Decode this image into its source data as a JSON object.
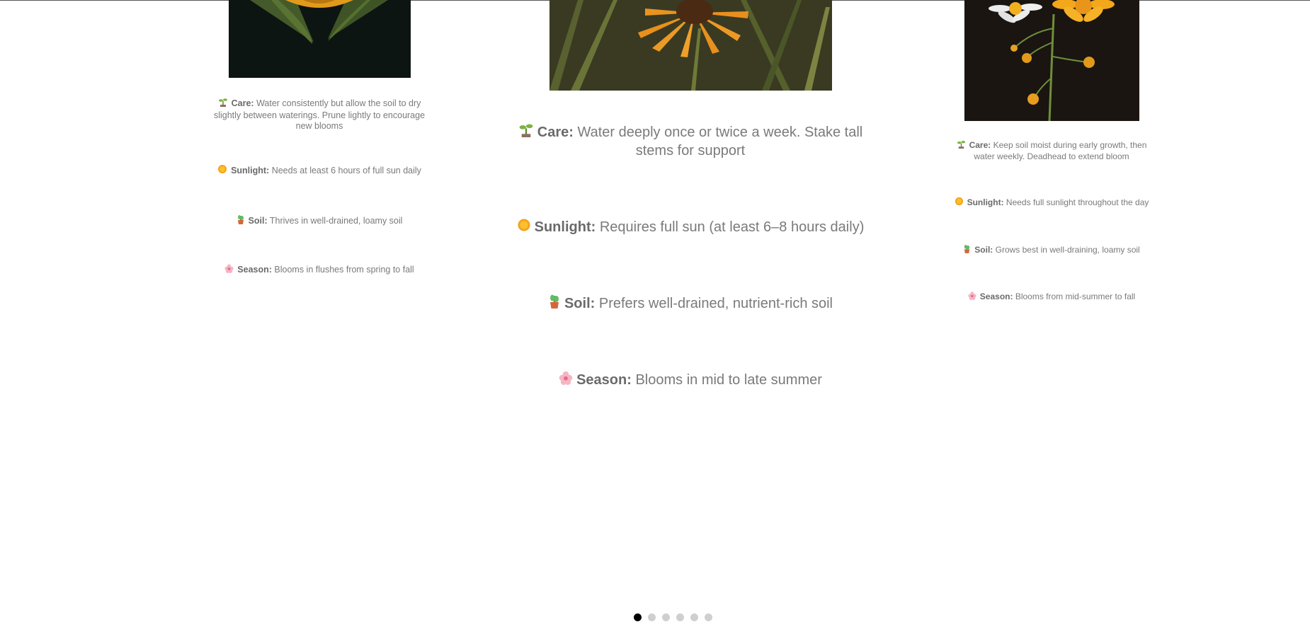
{
  "cards": [
    {
      "image_alt": "Sunflower bloom with leaves on dark background",
      "care_label": "Care:",
      "care_text": "Water consistently but allow the soil to dry slightly between waterings. Prune lightly to encourage new blooms",
      "sunlight_label": "Sunlight:",
      "sunlight_text": "Needs at least 6 hours of full sun daily",
      "soil_label": "Soil:",
      "soil_text": "Thrives in well-drained, loamy soil",
      "season_label": "Season:",
      "season_text": "Blooms in flushes from spring to fall"
    },
    {
      "image_alt": "Orange coneflower among tall grasses",
      "care_label": "Care:",
      "care_text": "Water deeply once or twice a week. Stake tall stems for support",
      "sunlight_label": "Sunlight:",
      "sunlight_text": "Requires full sun (at least 6–8 hours daily)",
      "soil_label": "Soil:",
      "soil_text": "Prefers well-drained, nutrient-rich soil",
      "season_label": "Season:",
      "season_text": "Blooms in mid to late summer"
    },
    {
      "image_alt": "White and yellow daisy-like flowers with buds on dark background",
      "care_label": "Care:",
      "care_text": "Keep soil moist during early growth, then water weekly. Deadhead to extend bloom",
      "sunlight_label": "Sunlight:",
      "sunlight_text": "Needs full sunlight throughout the day",
      "soil_label": "Soil:",
      "soil_text": "Grows best in well-draining, loamy soil",
      "season_label": "Season:",
      "season_text": "Blooms from mid-summer to fall"
    }
  ],
  "icons": {
    "care": "seedling-icon",
    "sunlight": "sun-icon",
    "soil": "potted-plant-icon",
    "season": "blossom-icon"
  },
  "carousel": {
    "dot_count": 6,
    "active_index": 0
  },
  "colors": {
    "background": "#ffffff",
    "text": "#777777",
    "dot_active": "#000000",
    "dot_inactive": "#cfcfcf"
  }
}
